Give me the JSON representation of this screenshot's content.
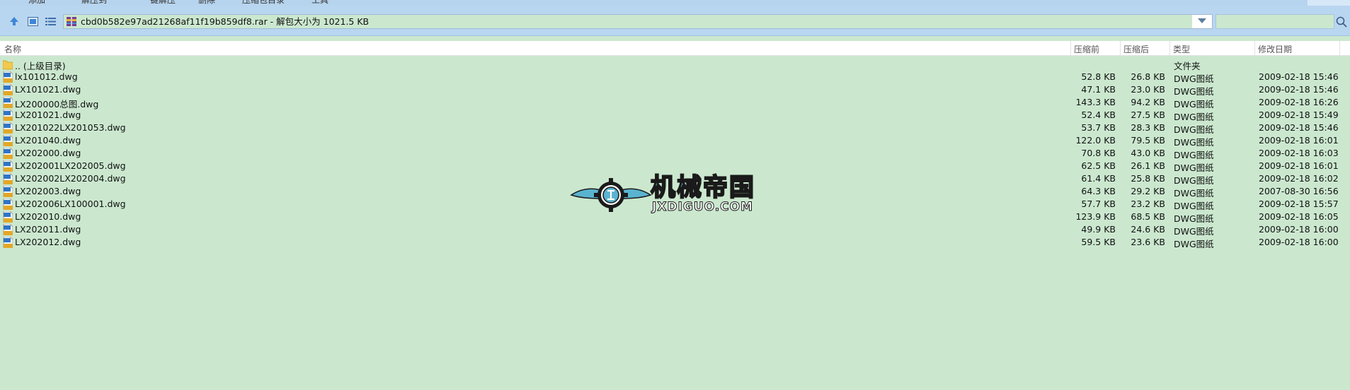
{
  "toolbar": {
    "partial_labels": [
      "添加",
      "解压到",
      "一键解压",
      "删除",
      "压缩包目录",
      "工具"
    ]
  },
  "address": {
    "text": "cbd0b582e97ad21268af11f19b859df8.rar - 解包大小为 1021.5 KB"
  },
  "columns": {
    "name": "名称",
    "before": "压缩前",
    "after": "压缩后",
    "type": "类型",
    "modified": "修改日期"
  },
  "parent": {
    "name": ".. (上级目录)",
    "type": "文件夹"
  },
  "files": [
    {
      "name": "lx101012.dwg",
      "before": "52.8 KB",
      "after": "26.8 KB",
      "type": "DWG图纸",
      "date": "2009-02-18 15:46"
    },
    {
      "name": "LX101021.dwg",
      "before": "47.1 KB",
      "after": "23.0 KB",
      "type": "DWG图纸",
      "date": "2009-02-18 15:46"
    },
    {
      "name": "LX200000总图.dwg",
      "before": "143.3 KB",
      "after": "94.2 KB",
      "type": "DWG图纸",
      "date": "2009-02-18 16:26"
    },
    {
      "name": "LX201021.dwg",
      "before": "52.4 KB",
      "after": "27.5 KB",
      "type": "DWG图纸",
      "date": "2009-02-18 15:49"
    },
    {
      "name": "LX201022LX201053.dwg",
      "before": "53.7 KB",
      "after": "28.3 KB",
      "type": "DWG图纸",
      "date": "2009-02-18 15:46"
    },
    {
      "name": "LX201040.dwg",
      "before": "122.0 KB",
      "after": "79.5 KB",
      "type": "DWG图纸",
      "date": "2009-02-18 16:01"
    },
    {
      "name": "LX202000.dwg",
      "before": "70.8 KB",
      "after": "43.0 KB",
      "type": "DWG图纸",
      "date": "2009-02-18 16:03"
    },
    {
      "name": "LX202001LX202005.dwg",
      "before": "62.5 KB",
      "after": "26.1 KB",
      "type": "DWG图纸",
      "date": "2009-02-18 16:01"
    },
    {
      "name": "LX202002LX202004.dwg",
      "before": "61.4 KB",
      "after": "25.8 KB",
      "type": "DWG图纸",
      "date": "2009-02-18 16:02"
    },
    {
      "name": "LX202003.dwg",
      "before": "64.3 KB",
      "after": "29.2 KB",
      "type": "DWG图纸",
      "date": "2007-08-30 16:56"
    },
    {
      "name": "LX202006LX100001.dwg",
      "before": "57.7 KB",
      "after": "23.2 KB",
      "type": "DWG图纸",
      "date": "2009-02-18 15:57"
    },
    {
      "name": "LX202010.dwg",
      "before": "123.9 KB",
      "after": "68.5 KB",
      "type": "DWG图纸",
      "date": "2009-02-18 16:05"
    },
    {
      "name": "LX202011.dwg",
      "before": "49.9 KB",
      "after": "24.6 KB",
      "type": "DWG图纸",
      "date": "2009-02-18 16:00"
    },
    {
      "name": "LX202012.dwg",
      "before": "59.5 KB",
      "after": "23.6 KB",
      "type": "DWG图纸",
      "date": "2009-02-18 16:00"
    }
  ],
  "watermark": {
    "cn": "机械帝国",
    "en": "JXDIGUO.COM"
  },
  "icons": {
    "up": "arrow-up-icon",
    "view": "thumbnail-view-icon",
    "list": "list-view-icon",
    "search": "search-icon",
    "folder": "folder-icon",
    "dwg": "dwg-file-icon"
  },
  "colors": {
    "background": "#cbe8cf",
    "toolbar": "#b9d6f1"
  }
}
